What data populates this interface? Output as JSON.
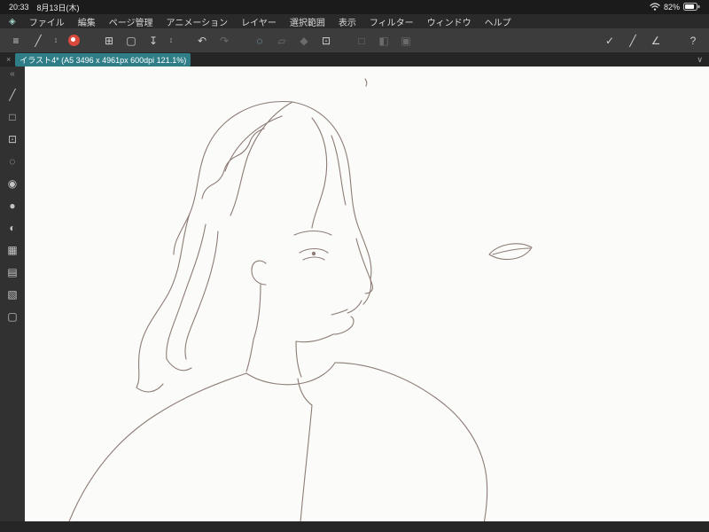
{
  "status_bar": {
    "time": "20:33",
    "date": "8月13日(木)",
    "battery_percent": "82%"
  },
  "menu_bar": {
    "items": [
      "ファイル",
      "編集",
      "ページ管理",
      "アニメーション",
      "レイヤー",
      "選択範囲",
      "表示",
      "フィルター",
      "ウィンドウ",
      "ヘルプ"
    ]
  },
  "toolbar": {
    "glyphs": {
      "menu": "≡",
      "pen": "╱",
      "pen_chevron": "↕",
      "new_canvas": "⊞",
      "open": "▢",
      "save": "↧",
      "save_chevron": "↕",
      "undo": "↶",
      "redo": "↷",
      "selection": "◌",
      "eraser": "▱",
      "fill": "◆",
      "crop": "⊡",
      "select_rect": "□",
      "gradient": "◧",
      "frame": "▣",
      "snap_check": "✓",
      "snap_pen": "╱",
      "snap_angle": "∠",
      "help": "?"
    }
  },
  "tab_bar": {
    "close": "×",
    "title": "イラスト4* (A5 3496 x 4961px 600dpi 121.1%)",
    "chevron": "∨"
  },
  "tool_sidebar": {
    "glyphs": {
      "collapse": "«",
      "pen": "╱",
      "balloon": "□",
      "text": "⊡",
      "airbrush": "◌",
      "decoration": "◉",
      "eyedropper": "●",
      "blend": "◐",
      "grid": "▦",
      "layers": "▤",
      "material": "▧",
      "folder": "▢"
    }
  },
  "colors": {
    "tab_accent": "#2e7d87",
    "logo_red": "#d94a3d",
    "sketch_line": "#8d7c75"
  }
}
